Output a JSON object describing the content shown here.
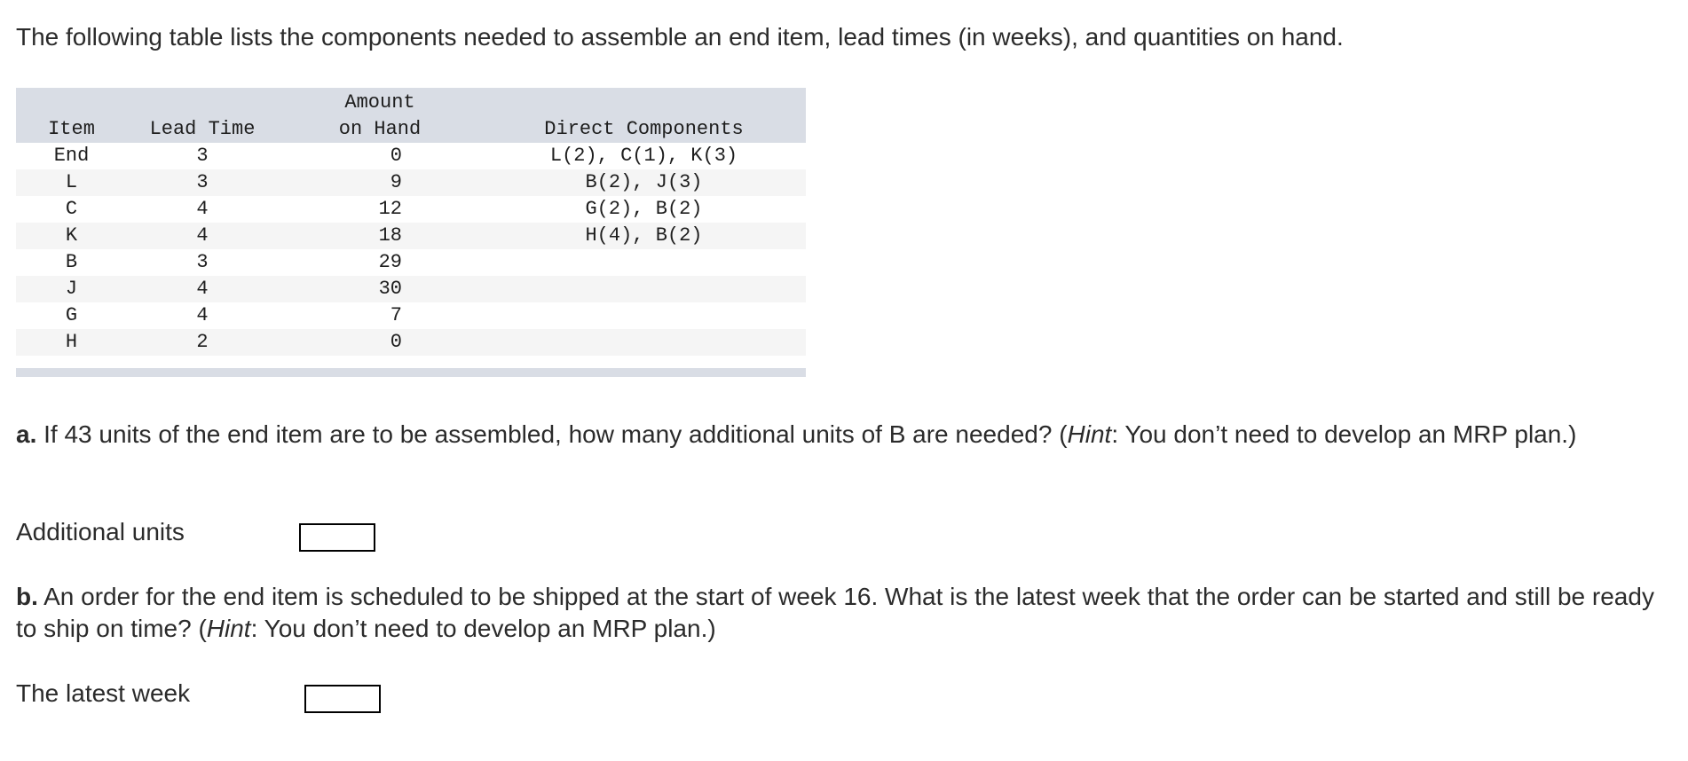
{
  "intro": "The following table lists the components needed to assemble an end item, lead times (in weeks), and quantities on hand.",
  "table": {
    "headers": {
      "item": "Item",
      "lead_time": "Lead Time",
      "amount_line1": "Amount",
      "amount_line2": "on Hand",
      "components": "Direct Components"
    },
    "rows": [
      {
        "item": "End",
        "lead_time": "3",
        "amount": "0",
        "components": "L(2), C(1), K(3)"
      },
      {
        "item": "L",
        "lead_time": "3",
        "amount": "9",
        "components": "B(2), J(3)"
      },
      {
        "item": "C",
        "lead_time": "4",
        "amount": "12",
        "components": "G(2), B(2)"
      },
      {
        "item": "K",
        "lead_time": "4",
        "amount": "18",
        "components": "H(4), B(2)"
      },
      {
        "item": "B",
        "lead_time": "3",
        "amount": "29",
        "components": ""
      },
      {
        "item": "J",
        "lead_time": "4",
        "amount": "30",
        "components": ""
      },
      {
        "item": "G",
        "lead_time": "4",
        "amount": "7",
        "components": ""
      },
      {
        "item": "H",
        "lead_time": "2",
        "amount": "0",
        "components": ""
      }
    ]
  },
  "question_a": {
    "label": "a.",
    "text_before_hint": " If 43 units of the end item are to be assembled, how many additional units of B are needed? (",
    "hint_word": "Hint",
    "text_after_hint": ": You don’t need to develop an MRP plan.)",
    "answer_label": "Additional units",
    "answer_value": ""
  },
  "question_b": {
    "label": "b.",
    "text_before_hint": " An order for the end item is scheduled to be shipped at the start of week 16. What is the latest week that the order can be started and still be ready to ship on time? (",
    "hint_word": "Hint",
    "text_after_hint": ": You don’t need to develop an MRP plan.)",
    "answer_label": "The latest week",
    "answer_value": ""
  },
  "colors": {
    "header_bg": "#d9dde5",
    "row_alt_bg": "#f5f5f5",
    "text": "#2b2b2b"
  }
}
